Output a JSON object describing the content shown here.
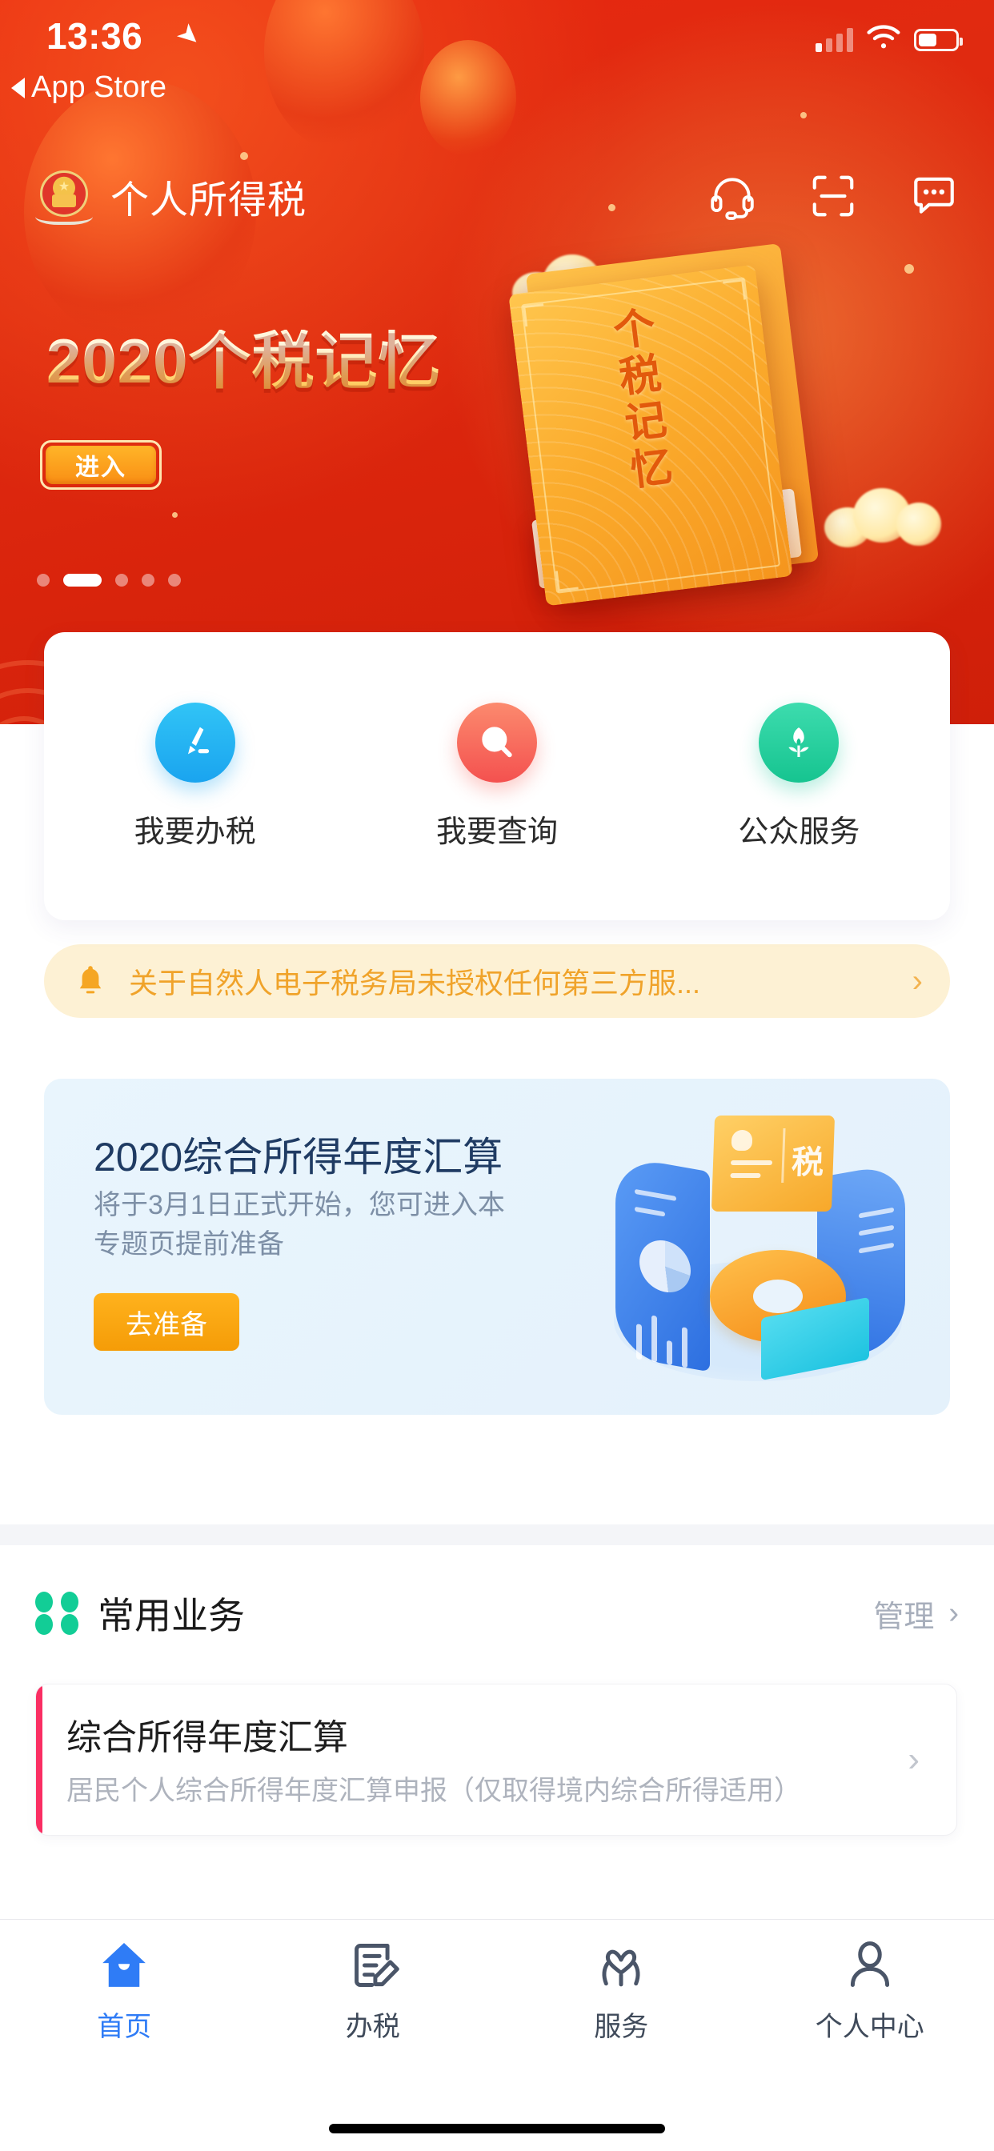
{
  "status_bar": {
    "time": "13:36",
    "back_label": "App Store",
    "location_icon": "location-arrow-icon",
    "signal_icon": "cellular-signal-icon",
    "wifi_icon": "wifi-icon",
    "battery_icon": "battery-icon"
  },
  "header": {
    "title": "个人所得税",
    "emblem_icon": "tax-bureau-emblem-icon",
    "icons": [
      {
        "name": "headset-icon",
        "label": "客服"
      },
      {
        "name": "scan-icon",
        "label": "扫一扫"
      },
      {
        "name": "message-icon",
        "label": "消息"
      }
    ]
  },
  "banner": {
    "title": "2020个税记忆",
    "button_label": "进入",
    "book_text": "个税记忆",
    "dots_total": 5,
    "dots_active_index": 1,
    "background_color": "#e02a10"
  },
  "quick_actions": [
    {
      "label": "我要办税",
      "icon": "pen-edit-icon",
      "color": "#1aa4ef"
    },
    {
      "label": "我要查询",
      "icon": "magnifier-icon",
      "color": "#f4514f"
    },
    {
      "label": "公众服务",
      "icon": "flower-icon",
      "color": "#16c490"
    }
  ],
  "notice": {
    "icon": "bell-icon",
    "text": "关于自然人电子税务局未授权任何第三方服...",
    "arrow_icon": "chevron-right-icon",
    "text_color": "#f0a32a",
    "background_color": "#fdf1d4"
  },
  "promo": {
    "title": "2020综合所得年度汇算",
    "subtitle": "将于3月1日正式开始，您可进入本专题页提前准备",
    "button_label": "去准备",
    "illustration_text": "税",
    "background_color": "#e7f2fc",
    "button_color": "#f7a510"
  },
  "section": {
    "icon": "four-petal-icon",
    "title": "常用业务",
    "manage_label": "管理",
    "manage_arrow_icon": "chevron-right-icon",
    "accent_color": "#12cd96"
  },
  "business_items": [
    {
      "title": "综合所得年度汇算",
      "desc": "居民个人综合所得年度汇算申报（仅取得境内综合所得适用）",
      "arrow_icon": "chevron-right-icon",
      "accent_color": "#fa2e63"
    }
  ],
  "tabbar": [
    {
      "label": "首页",
      "icon": "home-icon",
      "active": true
    },
    {
      "label": "办税",
      "icon": "document-edit-icon",
      "active": false
    },
    {
      "label": "服务",
      "icon": "heart-hands-icon",
      "active": false
    },
    {
      "label": "个人中心",
      "icon": "person-icon",
      "active": false
    }
  ],
  "tabbar_active_color": "#2f7cf6"
}
